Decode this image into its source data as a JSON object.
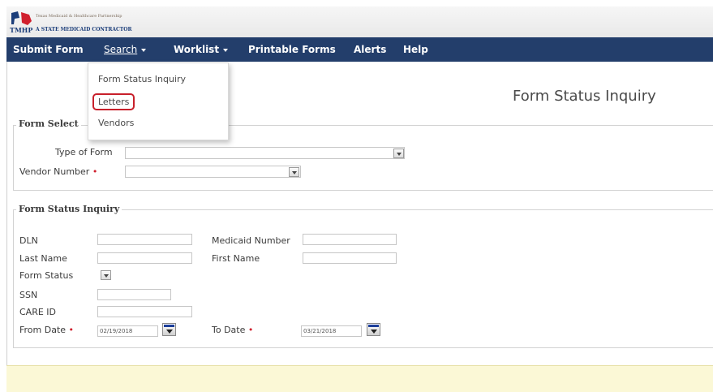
{
  "header": {
    "logo_abbr": "TMHP",
    "logo_line1": "Texas Medicaid & Healthcare Partnership",
    "logo_line2": "A STATE MEDICAID CONTRACTOR"
  },
  "nav": {
    "items": [
      {
        "label": "Submit Form"
      },
      {
        "label": "Search"
      },
      {
        "label": "Worklist"
      },
      {
        "label": "Printable Forms"
      },
      {
        "label": "Alerts"
      },
      {
        "label": "Help"
      }
    ]
  },
  "search_menu": {
    "items": [
      {
        "label": "Form Status Inquiry"
      },
      {
        "label": "Letters"
      },
      {
        "label": "Vendors"
      }
    ]
  },
  "page": {
    "title": "Form Status Inquiry"
  },
  "form_select": {
    "legend": "Form Select",
    "type_of_form_label": "Type of Form",
    "vendor_number_label": "Vendor Number",
    "required_mark": "•"
  },
  "form_status_inquiry": {
    "legend": "Form Status Inquiry",
    "dln_label": "DLN",
    "medicaid_number_label": "Medicaid Number",
    "last_name_label": "Last Name",
    "first_name_label": "First Name",
    "form_status_label": "Form Status",
    "ssn_label": "SSN",
    "care_id_label": "CARE ID",
    "from_date_label": "From Date",
    "from_date_value": "02/19/2018",
    "to_date_label": "To Date",
    "to_date_value": "03/21/2018"
  },
  "colors": {
    "navbar": "#233e6b",
    "required": "#d0202e",
    "highlight": "#c8202b",
    "footer": "#fbf8d6"
  }
}
